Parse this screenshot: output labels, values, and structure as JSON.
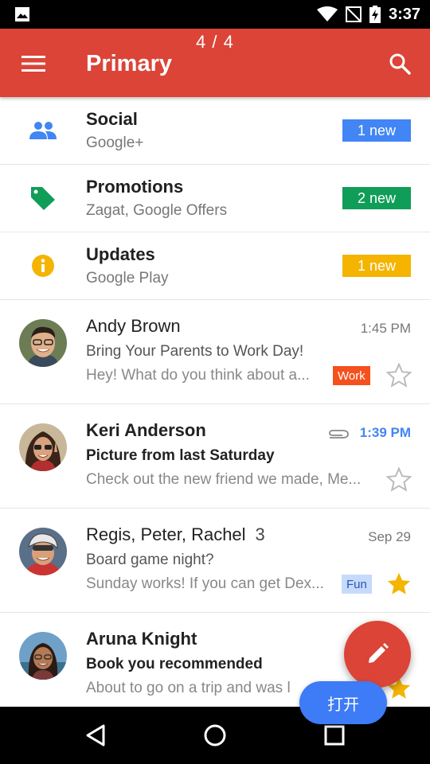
{
  "status_bar": {
    "time": "3:37"
  },
  "app_bar": {
    "title": "Primary",
    "counter": "4 / 4",
    "accent": "#DB4437"
  },
  "categories": [
    {
      "title": "Social",
      "subtitle": "Google+",
      "badge": "1 new",
      "badge_color": "#4285F4",
      "icon": "people-icon",
      "icon_color": "#4285F4"
    },
    {
      "title": "Promotions",
      "subtitle": "Zagat, Google Offers",
      "badge": "2 new",
      "badge_color": "#0F9D58",
      "icon": "tag-icon",
      "icon_color": "#0F9D58"
    },
    {
      "title": "Updates",
      "subtitle": "Google Play",
      "badge": "1 new",
      "badge_color": "#F4B400",
      "icon": "info-icon",
      "icon_color": "#F4B400"
    }
  ],
  "emails": [
    {
      "sender": "Andy Brown",
      "count": "",
      "time": "1:45 PM",
      "subject": "Bring Your Parents to Work Day!",
      "snippet": "Hey! What do you think about a...",
      "label": "Work",
      "starred": false,
      "unread": false,
      "attachment": false
    },
    {
      "sender": "Keri Anderson",
      "count": "",
      "time": "1:39 PM",
      "subject": "Picture from last Saturday",
      "snippet": "Check out the new friend we made, Me...",
      "label": "",
      "starred": false,
      "unread": true,
      "attachment": true
    },
    {
      "sender": "Regis, Peter, Rachel",
      "count": "3",
      "time": "Sep 29",
      "subject": "Board game night?",
      "snippet": "Sunday works! If you can get Dex...",
      "label": "Fun",
      "starred": true,
      "unread": false,
      "attachment": false
    },
    {
      "sender": "Aruna Knight",
      "count": "",
      "time": "",
      "subject": "Book you recommended",
      "snippet": "About to go on a trip and was l",
      "label": "",
      "starred": true,
      "unread": true,
      "attachment": false
    }
  ],
  "open_button": "打开",
  "icons": {
    "menu": "menu-icon",
    "search": "search-icon",
    "compose": "pencil-icon",
    "back": "back-triangle-icon",
    "home": "home-circle-icon",
    "recents": "recents-square-icon"
  }
}
